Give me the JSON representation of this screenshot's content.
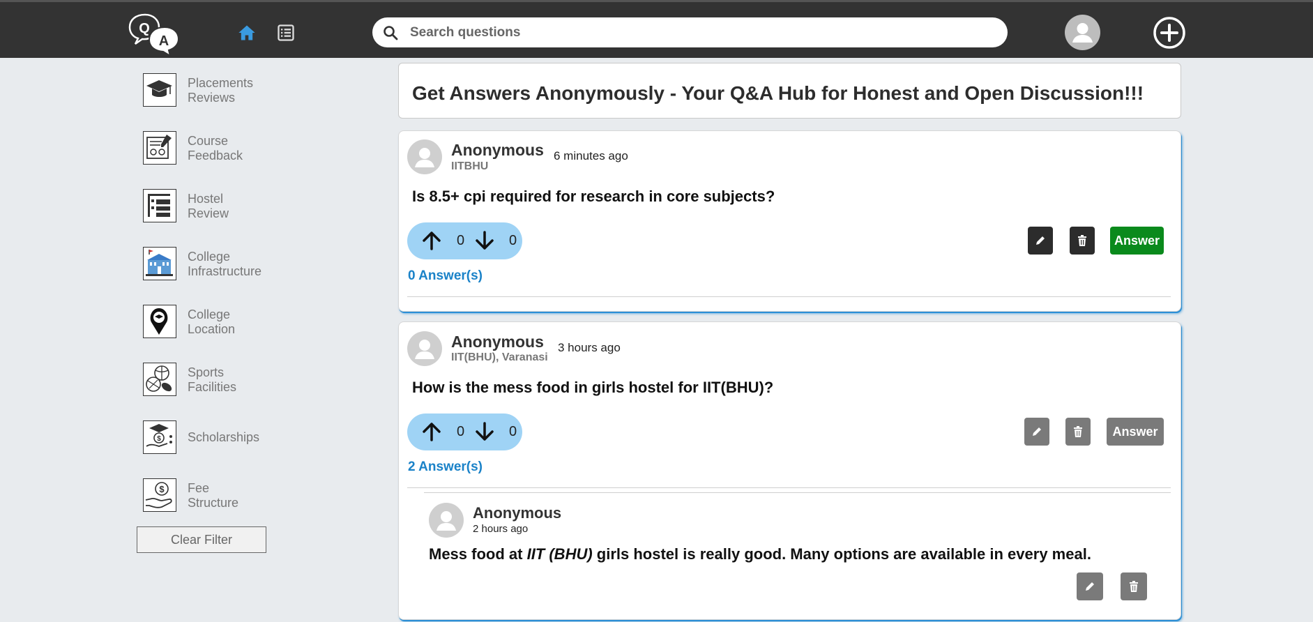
{
  "header": {
    "logo_letters": [
      "Q",
      "A"
    ],
    "search_placeholder": "Search questions"
  },
  "sidebar": {
    "items": [
      {
        "line1": "Placements",
        "line2": "Reviews",
        "icon": "graduation-cap-icon"
      },
      {
        "line1": "Course",
        "line2": "Feedback",
        "icon": "feedback-form-icon"
      },
      {
        "line1": "Hostel",
        "line2": "Review",
        "icon": "hostel-bed-icon"
      },
      {
        "line1": "College",
        "line2": "Infrastructure",
        "icon": "college-building-icon"
      },
      {
        "line1": "College",
        "line2": "Location",
        "icon": "location-pin-icon"
      },
      {
        "line1": "Sports",
        "line2": "Facilities",
        "icon": "sports-balls-icon"
      },
      {
        "line1": "Scholarships",
        "line2": "",
        "icon": "scholarship-icon"
      },
      {
        "line1": "Fee",
        "line2": "Structure",
        "icon": "fee-hand-coin-icon"
      }
    ],
    "clear_filter_label": "Clear Filter"
  },
  "main": {
    "hero_title": "Get Answers Anonymously - Your Q&A Hub for Honest and Open Discussion!!!",
    "questions": [
      {
        "author": "Anonymous",
        "college": "IITBHU",
        "time": "6 minutes ago",
        "text": "Is 8.5+ cpi required for research in core subjects?",
        "upvotes": "0",
        "downvotes": "0",
        "answer_count": "0 Answer(s)",
        "answer_label": "Answer",
        "answer_button_color": "#0a8a1c",
        "action_button_color": "#2c2c2c"
      },
      {
        "author": "Anonymous",
        "college": "IIT(BHU), Varanasi",
        "time": "3 hours ago",
        "text": "How is the mess food in girls hostel for IIT(BHU)?",
        "upvotes": "0",
        "downvotes": "0",
        "answer_count": "2 Answer(s)",
        "answer_label": "Answer",
        "answer_button_color": "#7a7a7a",
        "action_button_color": "#7a7a7a",
        "answers": [
          {
            "author": "Anonymous",
            "time": "2 hours ago",
            "text_before": "Mess food at ",
            "text_italic": "IIT (BHU)",
            "text_after": " girls hostel is really good. Many options are available in every meal."
          }
        ]
      }
    ]
  },
  "colors": {
    "header_bg": "#333333",
    "page_bg": "#e8ebee",
    "accent_blue": "#1a82c8",
    "vote_pill": "#9fd3f5",
    "home_icon": "#3a9be0"
  }
}
